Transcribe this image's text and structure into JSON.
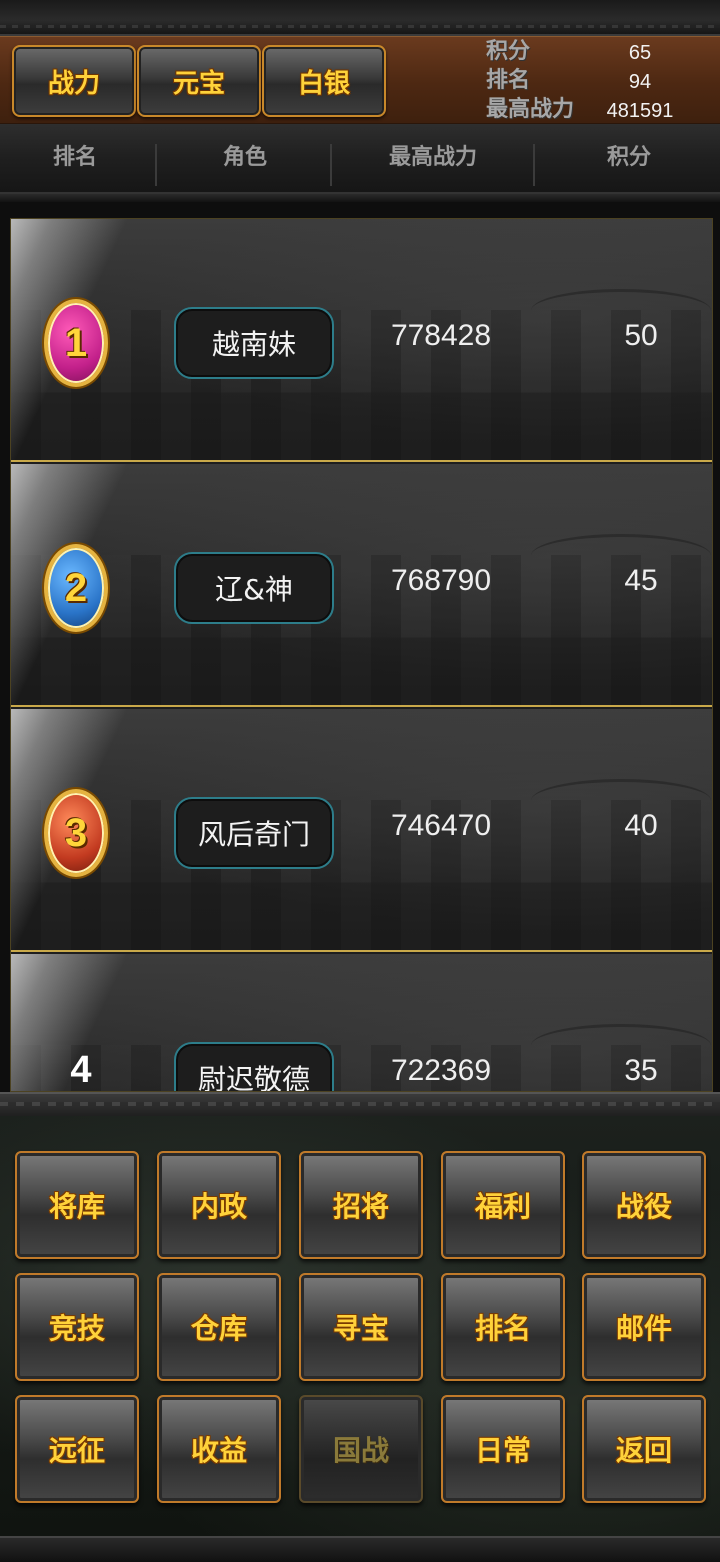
{
  "header": {
    "tabs": [
      {
        "label": "战力"
      },
      {
        "label": "元宝"
      },
      {
        "label": "白银"
      }
    ],
    "stats": {
      "score_label": "积分",
      "score_value": "65",
      "rank_label": "排名",
      "rank_value": "94",
      "max_power_label": "最高战力",
      "max_power_value": "481591"
    }
  },
  "columns": {
    "rank": "排名",
    "role": "角色",
    "max_power": "最高战力",
    "score": "积分"
  },
  "rows": [
    {
      "rank": "1",
      "name": "越南妹",
      "power": "778428",
      "score": "50",
      "medal_color": "#c2208a"
    },
    {
      "rank": "2",
      "name": "辽&神",
      "power": "768790",
      "score": "45",
      "medal_color": "#2a74c8"
    },
    {
      "rank": "3",
      "name": "风后奇门",
      "power": "746470",
      "score": "40",
      "medal_color": "#c23a20"
    },
    {
      "rank": "4",
      "name": "尉迟敬德",
      "power": "722369",
      "score": "35"
    }
  ],
  "menu": {
    "row1": [
      "将库",
      "内政",
      "招将",
      "福利",
      "战役"
    ],
    "row2": [
      "竞技",
      "仓库",
      "寻宝",
      "排名",
      "邮件"
    ],
    "row3": [
      "远征",
      "收益",
      "国战",
      "日常",
      "返回"
    ]
  },
  "colors": {
    "accent_gold": "#ffd23a",
    "header_brown": "#4d2812",
    "pill_border": "#2d7d8a",
    "row_divider": "#c9a94a"
  }
}
